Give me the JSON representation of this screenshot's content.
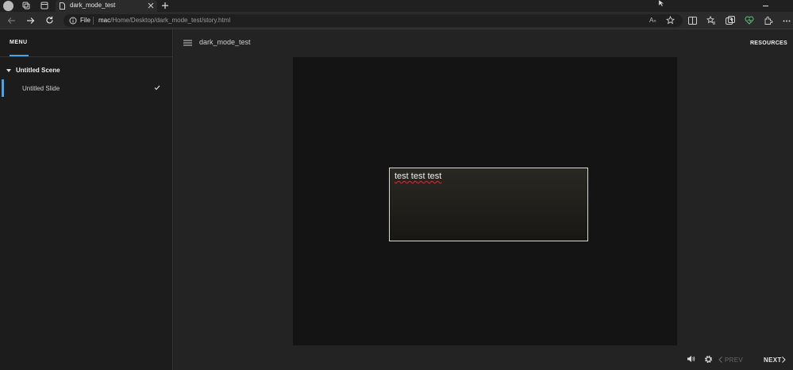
{
  "browser": {
    "tab_title": "dark_mode_test",
    "url_scheme_label": "File",
    "url_host": "mac",
    "url_path": "/Home/Desktop/dark_mode_test/story.html"
  },
  "sidebar": {
    "menu_label": "MENU",
    "scene_title": "Untitled Scene",
    "slide_label": "Untitled Slide"
  },
  "header": {
    "project_title": "dark_mode_test",
    "resources_label": "RESOURCES"
  },
  "slide": {
    "textbox_text": "test test test"
  },
  "footer": {
    "prev_label": "PREV",
    "next_label": "NEXT"
  }
}
